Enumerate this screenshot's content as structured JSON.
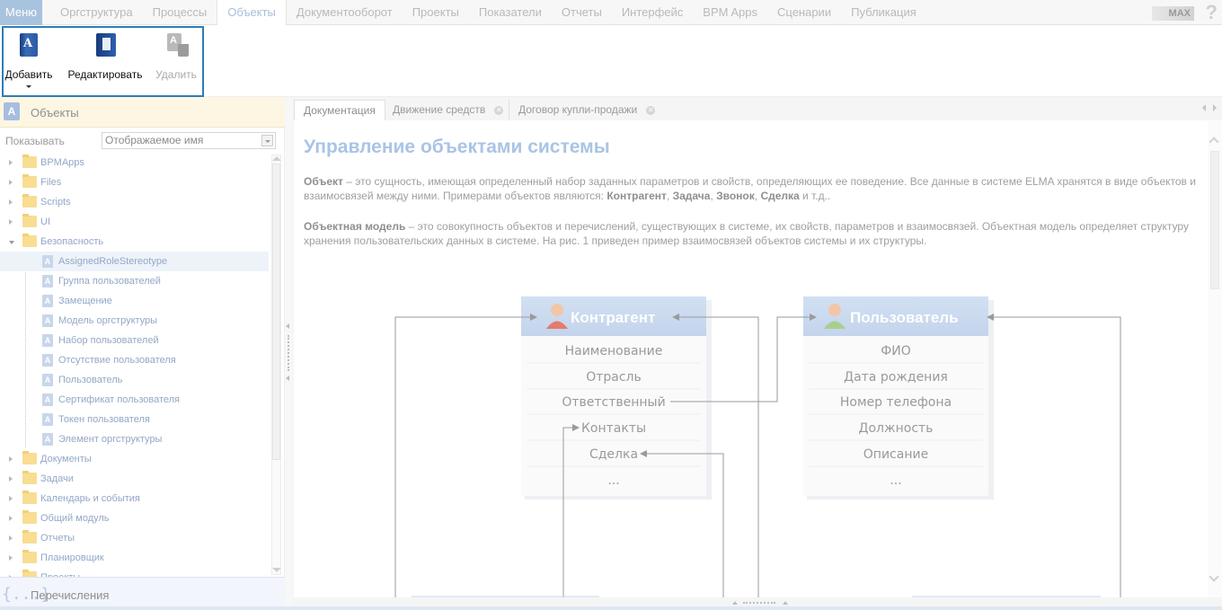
{
  "topbar": {
    "menu_label": "Меню",
    "tabs": [
      "Оргструктура",
      "Процессы",
      "Объекты",
      "Документооборот",
      "Проекты",
      "Показатели",
      "Отчеты",
      "Интерфейс",
      "BPM Apps",
      "Сценарии",
      "Публикация"
    ],
    "active_tab": "Объекты",
    "max_label": "MAX",
    "help_label": "?"
  },
  "toolbar": {
    "add_label": "Добавить",
    "edit_label": "Редактировать",
    "delete_label": "Удалить"
  },
  "left_panel": {
    "title": "Объекты",
    "show_label": "Показывать",
    "show_value": "Отображаемое имя",
    "tree": [
      {
        "label": "BPMApps",
        "kind": "folder",
        "level": 0,
        "expanded": false
      },
      {
        "label": "Files",
        "kind": "folder",
        "level": 0,
        "expanded": false
      },
      {
        "label": "Scripts",
        "kind": "folder",
        "level": 0,
        "expanded": false
      },
      {
        "label": "UI",
        "kind": "folder",
        "level": 0,
        "expanded": false
      },
      {
        "label": "Безопасность",
        "kind": "folder",
        "level": 0,
        "expanded": true
      },
      {
        "label": "AssignedRoleStereotype",
        "kind": "object",
        "level": 1,
        "selected": true
      },
      {
        "label": "Группа пользователей",
        "kind": "object",
        "level": 1
      },
      {
        "label": "Замещение",
        "kind": "object",
        "level": 1
      },
      {
        "label": "Модель оргструктуры",
        "kind": "object",
        "level": 1
      },
      {
        "label": "Набор пользователей",
        "kind": "object",
        "level": 1
      },
      {
        "label": "Отсутствие пользователя",
        "kind": "object",
        "level": 1
      },
      {
        "label": "Пользователь",
        "kind": "object",
        "level": 1
      },
      {
        "label": "Сертификат пользователя",
        "kind": "object",
        "level": 1
      },
      {
        "label": "Токен пользователя",
        "kind": "object",
        "level": 1
      },
      {
        "label": "Элемент оргструктуры",
        "kind": "object",
        "level": 1
      },
      {
        "label": "Документы",
        "kind": "folder",
        "level": 0,
        "expanded": false
      },
      {
        "label": "Задачи",
        "kind": "folder",
        "level": 0,
        "expanded": false
      },
      {
        "label": "Календарь и события",
        "kind": "folder",
        "level": 0,
        "expanded": false
      },
      {
        "label": "Общий модуль",
        "kind": "folder",
        "level": 0,
        "expanded": false
      },
      {
        "label": "Отчеты",
        "kind": "folder",
        "level": 0,
        "expanded": false
      },
      {
        "label": "Планировщик",
        "kind": "folder",
        "level": 0,
        "expanded": false
      },
      {
        "label": "Проекты",
        "kind": "folder",
        "level": 0,
        "expanded": false
      }
    ],
    "enum_label": "Перечисления",
    "enum_icon": "{...}"
  },
  "right_tabs": [
    {
      "label": "Документация",
      "active": true,
      "closable": false
    },
    {
      "label": "Движение средств",
      "active": false,
      "closable": true
    },
    {
      "label": "Договор купли-продажи",
      "active": false,
      "closable": true
    }
  ],
  "doc": {
    "title": "Управление объектами системы",
    "p1_term": "Объект",
    "p1_text_a": " – это сущность, имеющая определенный набор заданных параметров и свойств, определяющих ее поведение. Все данные в системе ELMA хранятся в виде объектов и взаимосвязей между ними. Примерами объектов являются: ",
    "p1_ex1": "Контрагент",
    "p1_sep1": ", ",
    "p1_ex2": "Задача",
    "p1_sep2": ", ",
    "p1_ex3": "Звонок",
    "p1_sep3": ", ",
    "p1_ex4": "Сделка",
    "p1_tail": " и т.д..",
    "p2_term": "Объектная модель",
    "p2_text": " – это совокупность объектов и перечислений, существующих в системе, их свойств, параметров и взаимосвязей. Объектная модель определяет структуру хранения пользовательских данных в системе. На рис. 1 приведен пример взаимосвязей объектов системы и их структуры.",
    "diagram": {
      "box1": {
        "title": "Контрагент",
        "fields": [
          "Наименование",
          "Отрасль",
          "Ответственный",
          "Контакты",
          "Сделка",
          "..."
        ]
      },
      "box2": {
        "title": "Пользователь",
        "fields": [
          "ФИО",
          "Дата рождения",
          "Номер телефона",
          "Должность",
          "Описание",
          "..."
        ]
      }
    }
  },
  "colors": {
    "accent": "#2e7db8",
    "menu_bg": "#a8c3de",
    "box_header": "#c9d9ef",
    "title": "#a9c4e6"
  }
}
